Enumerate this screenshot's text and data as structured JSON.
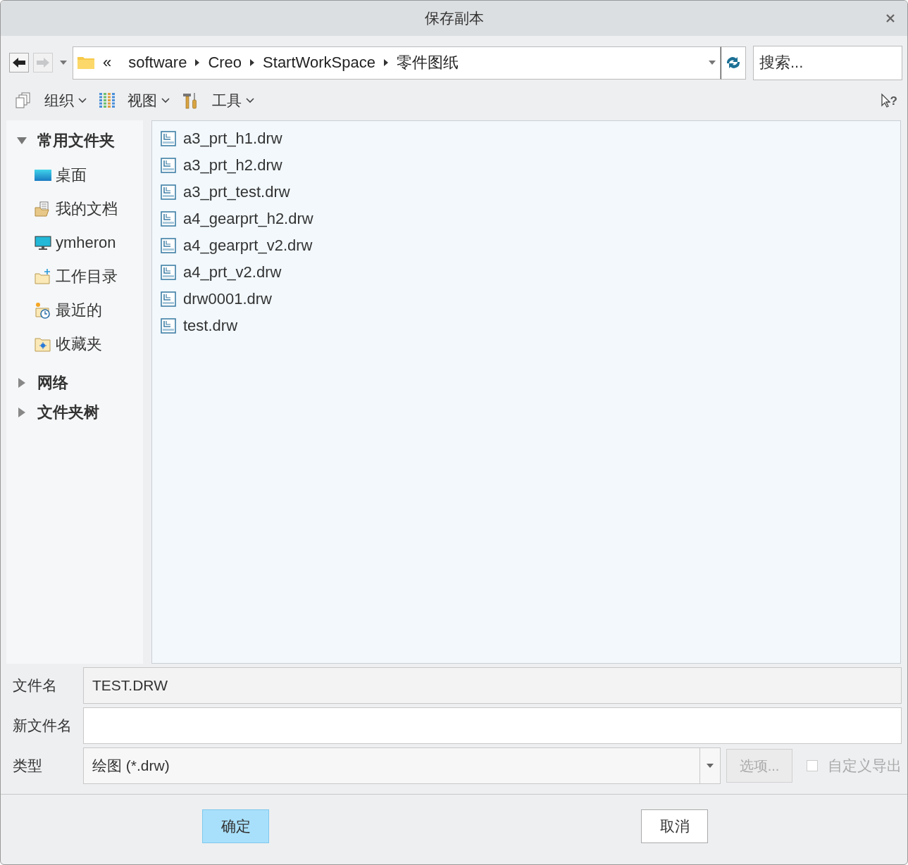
{
  "window": {
    "title": "保存副本"
  },
  "nav": {
    "back": {
      "disabled": false
    },
    "forward": {
      "disabled": true
    },
    "path_prefix": "«",
    "breadcrumbs": [
      "software",
      "Creo",
      "StartWorkSpace",
      "零件图纸"
    ],
    "search": {
      "placeholder": "搜索..."
    }
  },
  "toolbar": {
    "menus": [
      {
        "kind": "organize",
        "label": "组织"
      },
      {
        "kind": "view",
        "label": "视图"
      },
      {
        "kind": "tools",
        "label": "工具"
      }
    ],
    "help_mark": "?"
  },
  "sidebar": {
    "sections": [
      {
        "label": "常用文件夹",
        "expanded": true,
        "children": [
          {
            "kind": "desktop",
            "label": "桌面"
          },
          {
            "kind": "documents",
            "label": "我的文档"
          },
          {
            "kind": "computer",
            "label": "ymheron"
          },
          {
            "kind": "workdir",
            "label": "工作目录"
          },
          {
            "kind": "recent",
            "label": "最近的"
          },
          {
            "kind": "favorites",
            "label": "收藏夹"
          }
        ]
      },
      {
        "label": "网络",
        "expanded": false
      },
      {
        "label": "文件夹树",
        "expanded": false
      }
    ]
  },
  "files": [
    {
      "name": "a3_prt_h1.drw"
    },
    {
      "name": "a3_prt_h2.drw"
    },
    {
      "name": "a3_prt_test.drw"
    },
    {
      "name": "a4_gearprt_h2.drw"
    },
    {
      "name": "a4_gearprt_v2.drw"
    },
    {
      "name": "a4_prt_v2.drw"
    },
    {
      "name": "drw0001.drw"
    },
    {
      "name": "test.drw"
    }
  ],
  "form": {
    "file_name": {
      "label": "文件名",
      "value": "TEST.DRW"
    },
    "new_file_name": {
      "label": "新文件名"
    },
    "type": {
      "label": "类型",
      "value": "绘图 (*.drw)"
    },
    "options_button": {
      "label": "选项...",
      "disabled": true
    },
    "custom_export": {
      "label": "自定义导出",
      "checked": false,
      "disabled": true
    }
  },
  "buttons": [
    {
      "label": "确定",
      "default": true
    },
    {
      "label": "取消",
      "default": false
    }
  ]
}
